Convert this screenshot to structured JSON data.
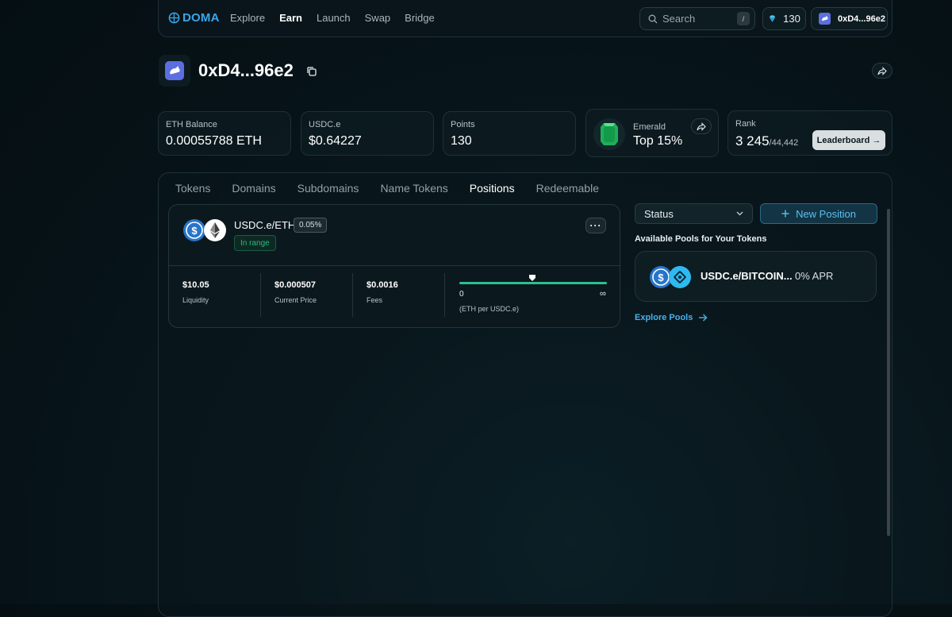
{
  "nav": {
    "logo_text": "DOMA",
    "links": [
      "Explore",
      "Earn",
      "Launch",
      "Swap",
      "Bridge"
    ],
    "active_link": "Earn",
    "search_placeholder": "Search",
    "search_shortcut": "/",
    "points": "130",
    "wallet_label": "0xD4...96e2"
  },
  "profile": {
    "name": "0xD4...96e2"
  },
  "stats": {
    "eth_label": "ETH Balance",
    "eth_value": "0.00055788 ETH",
    "usdc_label": "USDC.e",
    "usdc_value": "$0.64227",
    "points_label": "Points",
    "points_value": "130",
    "tier_label": "Emerald",
    "tier_value": "Top 15%",
    "rank_label": "Rank",
    "rank_value": "3 245",
    "rank_total": "/44,442",
    "leaderboard_label": "Leaderboard →"
  },
  "tabs": [
    "Tokens",
    "Domains",
    "Subdomains",
    "Name Tokens",
    "Positions",
    "Redeemable"
  ],
  "active_tab": "Positions",
  "position": {
    "pair": "USDC.e/ETH",
    "fee": "0.05%",
    "status": "In range",
    "more": "···",
    "liquidity_value": "$10.05",
    "liquidity_label": "Liquidity",
    "price_value": "$0.000507",
    "price_label": "Current Price",
    "fees_value": "$0.0016",
    "fees_label": "Fees",
    "range_min": "0",
    "range_max": "∞",
    "range_unit": "(ETH per USDC.e)"
  },
  "sidebar": {
    "status_label": "Status",
    "new_position_label": "New Position",
    "available_title": "Available Pools for Your Tokens",
    "pool_name": "USDC.e/BITCOIN...",
    "pool_apr": "0% APR",
    "explore_label": "Explore Pools"
  },
  "colors": {
    "accent_blue": "#3aa6e8",
    "range_green": "#2fbf8f",
    "usdc_blue": "#2775ca",
    "emerald": "#1fae5b"
  }
}
